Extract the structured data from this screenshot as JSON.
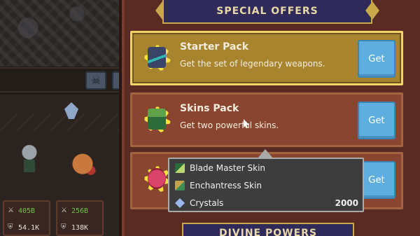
{
  "game": {
    "stats": [
      {
        "green": "405B",
        "white": "54.1K"
      },
      {
        "green": "256B",
        "white": "138K"
      }
    ]
  },
  "shop": {
    "header": "SPECIAL OFFERS",
    "footer_header": "DIVINE POWERS",
    "offers": [
      {
        "title": "Starter Pack",
        "description": "Get the set of legendary weapons.",
        "button": "Get",
        "highlighted": true
      },
      {
        "title": "Skins Pack",
        "description": "Get two powerful skins.",
        "button": "Get"
      },
      {
        "title": "",
        "description": "",
        "button": "Get"
      }
    ]
  },
  "tooltip": {
    "items": [
      {
        "label": "Blade Master Skin",
        "value": "",
        "icon": "blade-master-icon"
      },
      {
        "label": "Enchantress Skin",
        "value": "",
        "icon": "enchantress-icon"
      },
      {
        "label": "Crystals",
        "value": "2000",
        "icon": "crystal-icon"
      }
    ]
  },
  "colors": {
    "panel": "#5a2b22",
    "highlight_offer": "#a8842f",
    "get_button": "#5eaee0",
    "banner": "#2f2a5a",
    "gold_trim": "#c9a84a"
  }
}
